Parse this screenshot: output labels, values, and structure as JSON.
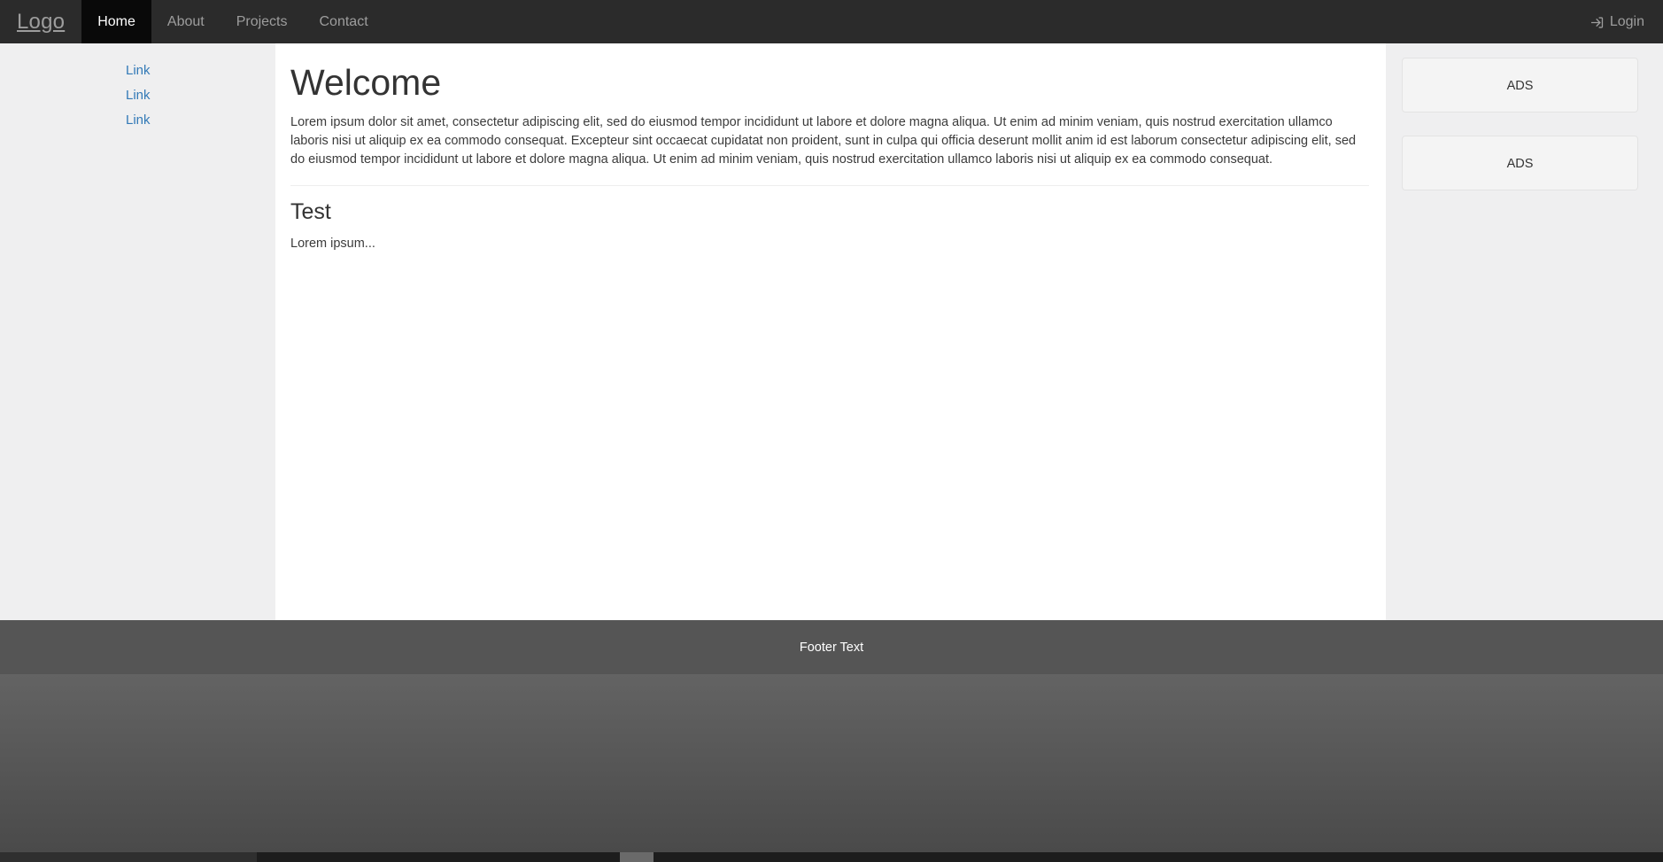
{
  "navbar": {
    "brand": "Logo",
    "items": [
      {
        "label": "Home",
        "active": true
      },
      {
        "label": "About",
        "active": false
      },
      {
        "label": "Projects",
        "active": false
      },
      {
        "label": "Contact",
        "active": false
      }
    ],
    "login_label": "Login",
    "login_icon": "sign-in-icon",
    "background_color": "#2b2b2b",
    "active_background_color": "#090909",
    "text_color": "#9d9d9d"
  },
  "sidebar": {
    "links": [
      {
        "label": "Link"
      },
      {
        "label": "Link"
      },
      {
        "label": "Link"
      }
    ],
    "link_color": "#337ab7"
  },
  "main": {
    "heading": "Welcome",
    "paragraph": "Lorem ipsum dolor sit amet, consectetur adipiscing elit, sed do eiusmod tempor incididunt ut labore et dolore magna aliqua. Ut enim ad minim veniam, quis nostrud exercitation ullamco laboris nisi ut aliquip ex ea commodo consequat. Excepteur sint occaecat cupidatat non proident, sunt in culpa qui officia deserunt mollit anim id est laborum consectetur adipiscing elit, sed do eiusmod tempor incididunt ut labore et dolore magna aliqua. Ut enim ad minim veniam, quis nostrud exercitation ullamco laboris nisi ut aliquip ex ea commodo consequat.",
    "subheading": "Test",
    "subparagraph": "Lorem ipsum..."
  },
  "rail": {
    "ads": [
      {
        "label": "ADS"
      },
      {
        "label": "ADS"
      }
    ]
  },
  "footer": {
    "text": "Footer Text",
    "background_color": "#555555"
  }
}
